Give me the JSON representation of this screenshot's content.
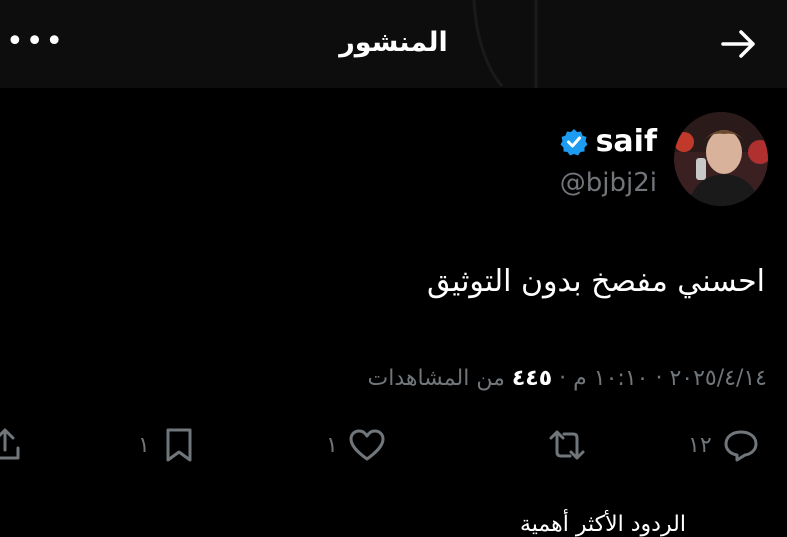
{
  "header": {
    "title": "المنشور",
    "more_label": "•••"
  },
  "author": {
    "name": "saif",
    "handle": "@bjbj2i",
    "verified_color": "#1d9bf0"
  },
  "post": {
    "text": "احسني مفصخ بدون التوثيق",
    "meta_datetime": "٢٠٢٥/٤/١٤ · ١٠:١٠ م ·",
    "views_count": "٤٤٥",
    "views_label": "من المشاهدات"
  },
  "actions": {
    "replies": "١٢",
    "reposts": "",
    "likes": "١",
    "bookmarks": "١"
  },
  "icons": [
    "back-arrow-icon",
    "more-icon",
    "verified-icon",
    "reply-icon",
    "repost-icon",
    "like-icon",
    "bookmark-icon",
    "share-icon"
  ],
  "partial_text": "الردود الأكثر أهمية"
}
